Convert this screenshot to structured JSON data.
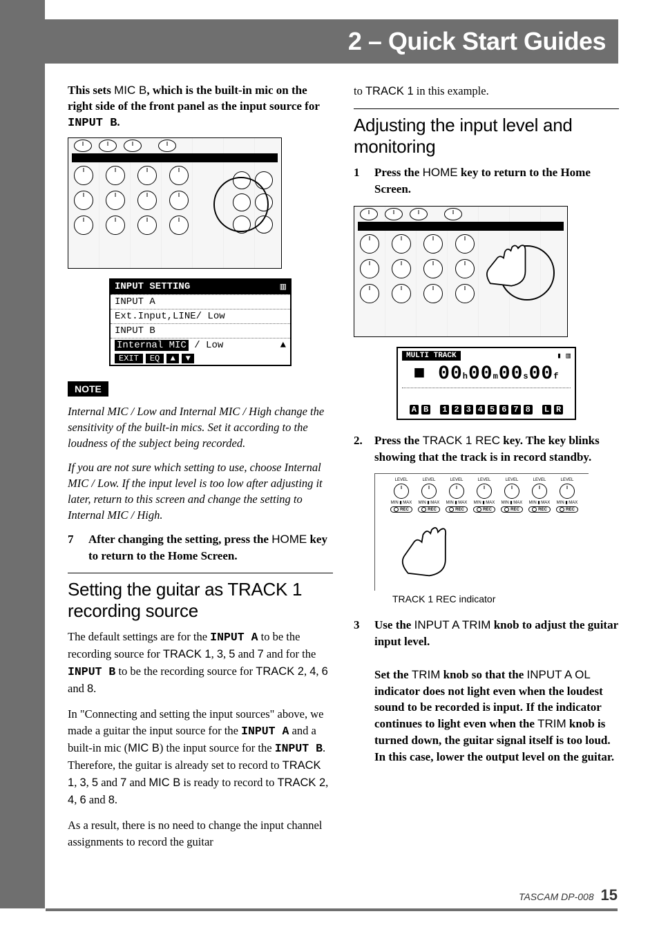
{
  "header": {
    "title": "2 – Quick Start Guides"
  },
  "left": {
    "intro_html": [
      "This sets ",
      "MIC B",
      ", which is the built-in mic on the right side of the front panel as the input source for ",
      "INPUT B",
      "."
    ],
    "intro_1": "This sets ",
    "intro_2": "MIC B",
    "intro_3": ", which is the built-in mic on the right side of the front panel as the input source for ",
    "intro_4": "INPUT B",
    "intro_5": ".",
    "lcd": {
      "title": "INPUT SETTING",
      "r1": "INPUT A",
      "r2": "Ext.Input,LINE/ Low",
      "r3": "INPUT B",
      "r4a": "Internal MIC",
      "r4b": "/ Low",
      "f1": "EXIT",
      "f2": "EQ"
    },
    "note_label": "NOTE",
    "note_p1": "Internal MIC / Low and Internal MIC / High change the sensitivity of the built-in mics. Set it according to the loudness of the subject being recorded.",
    "note_p2": "If you are not sure which setting to use, choose Internal MIC / Low. If the input level is too low after adjusting it later, return to this screen and change the setting to Internal MIC / High.",
    "step7_num": "7",
    "step7_a": "After changing the setting, press the ",
    "step7_b": "HOME",
    "step7_c": " key to return to the Home Screen.",
    "h2": "Setting the guitar as TRACK 1 recording source",
    "p1_a": "The default settings are for the ",
    "p1_b": "INPUT A",
    "p1_c": " to be the recording source for ",
    "p1_d": "TRACK 1",
    "p1_e": ", ",
    "p1_f": "3",
    "p1_g": ", ",
    "p1_h": "5",
    "p1_i": " and ",
    "p1_j": "7",
    "p1_k": " and for the ",
    "p1_l": "INPUT B",
    "p1_m": " to be the recording source for ",
    "p1_n": "TRACK 2",
    "p1_o": ", ",
    "p1_p": "4",
    "p1_q": ", ",
    "p1_r": "6",
    "p1_s": " and ",
    "p1_t": "8",
    "p1_u": ".",
    "p2_a": "In \"Connecting and setting the input sources\" above, we made a guitar the input source for the ",
    "p2_b": "INPUT A",
    "p2_c": " and a built-in mic (",
    "p2_d": "MIC B",
    "p2_e": ") the input source for the ",
    "p2_f": "INPUT B",
    "p2_g": ". Therefore, the guitar is already set to record to ",
    "p2_h": "TRACK 1",
    "p2_i": ", ",
    "p2_j": "3",
    "p2_k": ", ",
    "p2_l": "5",
    "p2_m": " and ",
    "p2_n": "7",
    "p2_o": " and ",
    "p2_p": "MIC B",
    "p2_q": " is ready to record to ",
    "p2_r": "TRACK 2",
    "p2_s": ", ",
    "p2_t": "4",
    "p2_u": ", ",
    "p2_v": "6",
    "p2_w": " and ",
    "p2_x": "8",
    "p2_y": ".",
    "p3": "As a result, there is no need to change the input channel assignments to record the guitar "
  },
  "right": {
    "cont_a": "to ",
    "cont_b": "TRACK 1",
    "cont_c": " in this example.",
    "h2": "Adjusting the input level and monitoring",
    "step1_num": "1",
    "step1_a": "Press the ",
    "step1_b": "HOME",
    "step1_c": " key to return to the Home Screen.",
    "home_lcd": {
      "tag": "MULTI TRACK",
      "tc": "00h00m00s00f",
      "meters": [
        "A",
        "B",
        " ",
        "1",
        "2",
        "3",
        "4",
        "5",
        "6",
        "7",
        "8",
        " ",
        "L",
        "R"
      ]
    },
    "step2_num": "2.",
    "step2_a": "Press the ",
    "step2_b": "TRACK 1 REC",
    "step2_c": " key. The key blinks showing that the track is in record standby.",
    "caption": "TRACK 1 REC indicator",
    "step3_num": "3",
    "step3_a": "Use the ",
    "step3_b": "INPUT A TRIM",
    "step3_c": " knob to adjust the guitar input level.",
    "step3_p_a": "Set the ",
    "step3_p_b": "TRIM",
    "step3_p_c": " knob so that the ",
    "step3_p_d": "INPUT A OL",
    "step3_p_e": " indicator does not light even when the loudest sound to be recorded is input. If the indicator continues to light even when the ",
    "step3_p_f": "TRIM",
    "step3_p_g": " knob is turned down, the guitar signal itself is too loud. In this case, lower the output level on the guitar."
  },
  "footer": {
    "brand": "TASCAM DP-008",
    "page": "15"
  }
}
